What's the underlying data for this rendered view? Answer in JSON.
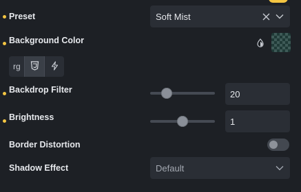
{
  "properties": {
    "preset": {
      "label": "Preset",
      "value": "Soft Mist",
      "clear_icon": "close-icon",
      "dropdown_icon": "chevron-down-icon"
    },
    "background_color": {
      "label": "Background Color",
      "mode_text": "rg",
      "mode_icons": [
        "css-shield-icon",
        "bolt-icon"
      ],
      "picker_icon": "droplet-icon",
      "swatch_pattern": "transparency-checkerboard",
      "swatch_colors": [
        "#1f3a37",
        "#3e5a57"
      ]
    },
    "backdrop_filter": {
      "label": "Backdrop Filter",
      "value": "20",
      "slider_level": 0.2
    },
    "brightness": {
      "label": "Brightness",
      "value": "1",
      "slider_level": 0.5
    },
    "border_distortion": {
      "label": "Border Distortion",
      "enabled": false
    },
    "shadow_effect": {
      "label": "Shadow Effect",
      "value": "Default",
      "dropdown_icon": "chevron-down-icon"
    }
  },
  "colors": {
    "accent": "#f4c542",
    "background": "#1d2025",
    "control": "#2a2e35"
  }
}
